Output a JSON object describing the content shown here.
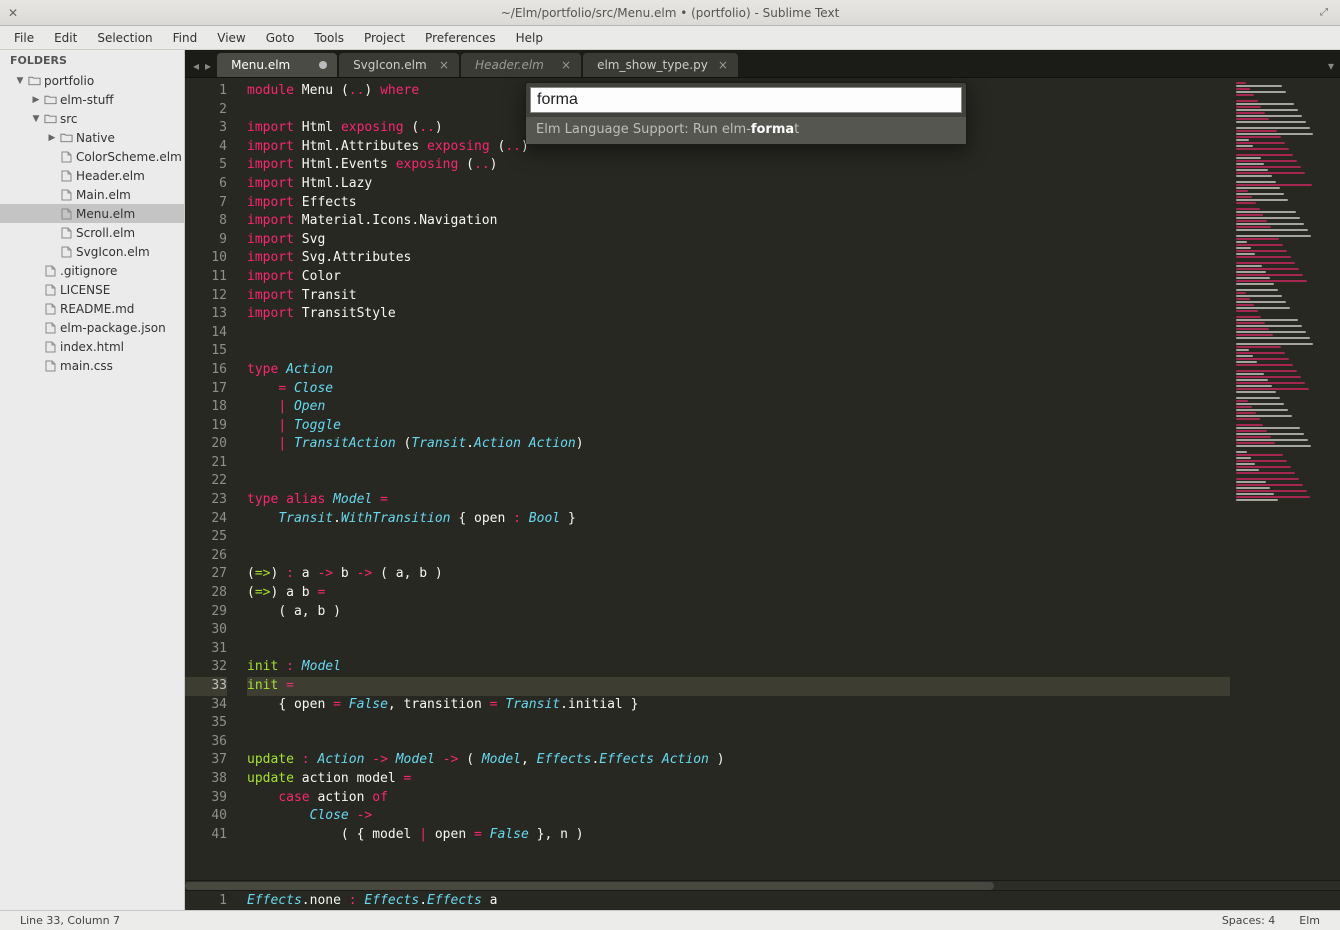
{
  "window": {
    "title": "~/Elm/portfolio/src/Menu.elm • (portfolio) - Sublime Text"
  },
  "menubar": [
    "File",
    "Edit",
    "Selection",
    "Find",
    "View",
    "Goto",
    "Tools",
    "Project",
    "Preferences",
    "Help"
  ],
  "sidebar": {
    "header": "FOLDERS",
    "tree": [
      {
        "depth": 0,
        "kind": "folder",
        "open": true,
        "label": "portfolio"
      },
      {
        "depth": 1,
        "kind": "folder",
        "open": false,
        "label": "elm-stuff"
      },
      {
        "depth": 1,
        "kind": "folder",
        "open": true,
        "label": "src"
      },
      {
        "depth": 2,
        "kind": "folder",
        "open": false,
        "label": "Native"
      },
      {
        "depth": 2,
        "kind": "file",
        "label": "ColorScheme.elm"
      },
      {
        "depth": 2,
        "kind": "file",
        "label": "Header.elm"
      },
      {
        "depth": 2,
        "kind": "file",
        "label": "Main.elm"
      },
      {
        "depth": 2,
        "kind": "file",
        "label": "Menu.elm",
        "selected": true
      },
      {
        "depth": 2,
        "kind": "file",
        "label": "Scroll.elm"
      },
      {
        "depth": 2,
        "kind": "file",
        "label": "SvgIcon.elm"
      },
      {
        "depth": 1,
        "kind": "file",
        "label": ".gitignore"
      },
      {
        "depth": 1,
        "kind": "file",
        "label": "LICENSE"
      },
      {
        "depth": 1,
        "kind": "file",
        "label": "README.md"
      },
      {
        "depth": 1,
        "kind": "file",
        "label": "elm-package.json"
      },
      {
        "depth": 1,
        "kind": "file",
        "label": "index.html"
      },
      {
        "depth": 1,
        "kind": "file",
        "label": "main.css"
      }
    ]
  },
  "tabs": [
    {
      "label": "Menu.elm",
      "active": true,
      "dirty": true
    },
    {
      "label": "SvgIcon.elm",
      "active": false,
      "dirty": false
    },
    {
      "label": "Header.elm",
      "active": false,
      "dirty": false,
      "italic": true
    },
    {
      "label": "elm_show_type.py",
      "active": false,
      "dirty": false
    }
  ],
  "palette": {
    "input": "forma",
    "result_prefix": "Elm Language Support: Run elm-",
    "result_match": "forma",
    "result_suffix": "t"
  },
  "code": {
    "start_line": 1,
    "current_line": 33,
    "lines": [
      [
        [
          "kw",
          "module"
        ],
        [
          "ident",
          " Menu "
        ],
        [
          "punc",
          "("
        ],
        [
          "op",
          ".."
        ],
        [
          "punc",
          ") "
        ],
        [
          "kw",
          "where"
        ]
      ],
      [],
      [
        [
          "kw",
          "import"
        ],
        [
          "ident",
          " Html "
        ],
        [
          "kw",
          "exposing"
        ],
        [
          "punc",
          " ("
        ],
        [
          "op",
          ".."
        ],
        [
          "punc",
          ")"
        ]
      ],
      [
        [
          "kw",
          "import"
        ],
        [
          "ident",
          " Html.Attributes "
        ],
        [
          "kw",
          "exposing"
        ],
        [
          "punc",
          " ("
        ],
        [
          "op",
          ".."
        ],
        [
          "punc",
          ")"
        ]
      ],
      [
        [
          "kw",
          "import"
        ],
        [
          "ident",
          " Html.Events "
        ],
        [
          "kw",
          "exposing"
        ],
        [
          "punc",
          " ("
        ],
        [
          "op",
          ".."
        ],
        [
          "punc",
          ")"
        ]
      ],
      [
        [
          "kw",
          "import"
        ],
        [
          "ident",
          " Html.Lazy"
        ]
      ],
      [
        [
          "kw",
          "import"
        ],
        [
          "ident",
          " Effects"
        ]
      ],
      [
        [
          "kw",
          "import"
        ],
        [
          "ident",
          " Material.Icons.Navigation"
        ]
      ],
      [
        [
          "kw",
          "import"
        ],
        [
          "ident",
          " Svg"
        ]
      ],
      [
        [
          "kw",
          "import"
        ],
        [
          "ident",
          " Svg.Attributes"
        ]
      ],
      [
        [
          "kw",
          "import"
        ],
        [
          "ident",
          " Color"
        ]
      ],
      [
        [
          "kw",
          "import"
        ],
        [
          "ident",
          " Transit"
        ]
      ],
      [
        [
          "kw",
          "import"
        ],
        [
          "ident",
          " TransitStyle"
        ]
      ],
      [],
      [],
      [
        [
          "kw",
          "type"
        ],
        [
          "ident",
          " "
        ],
        [
          "type",
          "Action"
        ]
      ],
      [
        [
          "ident",
          "    "
        ],
        [
          "op",
          "="
        ],
        [
          "ident",
          " "
        ],
        [
          "const",
          "Close"
        ]
      ],
      [
        [
          "ident",
          "    "
        ],
        [
          "op",
          "|"
        ],
        [
          "ident",
          " "
        ],
        [
          "const",
          "Open"
        ]
      ],
      [
        [
          "ident",
          "    "
        ],
        [
          "op",
          "|"
        ],
        [
          "ident",
          " "
        ],
        [
          "const",
          "Toggle"
        ]
      ],
      [
        [
          "ident",
          "    "
        ],
        [
          "op",
          "|"
        ],
        [
          "ident",
          " "
        ],
        [
          "const",
          "TransitAction"
        ],
        [
          "punc",
          " ("
        ],
        [
          "type",
          "Transit"
        ],
        [
          "punc",
          "."
        ],
        [
          "type",
          "Action"
        ],
        [
          "ident",
          " "
        ],
        [
          "type",
          "Action"
        ],
        [
          "punc",
          ")"
        ]
      ],
      [],
      [],
      [
        [
          "kw",
          "type"
        ],
        [
          "ident",
          " "
        ],
        [
          "kw",
          "alias"
        ],
        [
          "ident",
          " "
        ],
        [
          "type",
          "Model"
        ],
        [
          "ident",
          " "
        ],
        [
          "op",
          "="
        ]
      ],
      [
        [
          "ident",
          "    "
        ],
        [
          "type",
          "Transit"
        ],
        [
          "punc",
          "."
        ],
        [
          "type",
          "WithTransition"
        ],
        [
          "ident",
          " "
        ],
        [
          "punc",
          "{"
        ],
        [
          "ident",
          " open "
        ],
        [
          "op",
          ":"
        ],
        [
          "ident",
          " "
        ],
        [
          "type",
          "Bool"
        ],
        [
          "ident",
          " "
        ],
        [
          "punc",
          "}"
        ]
      ],
      [],
      [],
      [
        [
          "punc",
          "("
        ],
        [
          "fn",
          "=>"
        ],
        [
          "punc",
          ") "
        ],
        [
          "op",
          ":"
        ],
        [
          "ident",
          " a "
        ],
        [
          "op",
          "->"
        ],
        [
          "ident",
          " b "
        ],
        [
          "op",
          "->"
        ],
        [
          "ident",
          " "
        ],
        [
          "punc",
          "("
        ],
        [
          "ident",
          " a"
        ],
        [
          "punc",
          ","
        ],
        [
          "ident",
          " b "
        ],
        [
          "punc",
          ")"
        ]
      ],
      [
        [
          "punc",
          "("
        ],
        [
          "fn",
          "=>"
        ],
        [
          "punc",
          ")"
        ],
        [
          "ident",
          " a b "
        ],
        [
          "op",
          "="
        ]
      ],
      [
        [
          "ident",
          "    "
        ],
        [
          "punc",
          "("
        ],
        [
          "ident",
          " a"
        ],
        [
          "punc",
          ","
        ],
        [
          "ident",
          " b "
        ],
        [
          "punc",
          ")"
        ]
      ],
      [],
      [],
      [
        [
          "fn",
          "init"
        ],
        [
          "ident",
          " "
        ],
        [
          "op",
          ":"
        ],
        [
          "ident",
          " "
        ],
        [
          "type",
          "Model"
        ]
      ],
      [
        [
          "fn",
          "init"
        ],
        [
          "ident",
          " "
        ],
        [
          "op",
          "="
        ]
      ],
      [
        [
          "ident",
          "    "
        ],
        [
          "punc",
          "{"
        ],
        [
          "ident",
          " open "
        ],
        [
          "op",
          "="
        ],
        [
          "ident",
          " "
        ],
        [
          "const",
          "False"
        ],
        [
          "punc",
          ","
        ],
        [
          "ident",
          " transition "
        ],
        [
          "op",
          "="
        ],
        [
          "ident",
          " "
        ],
        [
          "type",
          "Transit"
        ],
        [
          "punc",
          "."
        ],
        [
          "ident",
          "initial "
        ],
        [
          "punc",
          "}"
        ]
      ],
      [],
      [],
      [
        [
          "fn",
          "update"
        ],
        [
          "ident",
          " "
        ],
        [
          "op",
          ":"
        ],
        [
          "ident",
          " "
        ],
        [
          "type",
          "Action"
        ],
        [
          "ident",
          " "
        ],
        [
          "op",
          "->"
        ],
        [
          "ident",
          " "
        ],
        [
          "type",
          "Model"
        ],
        [
          "ident",
          " "
        ],
        [
          "op",
          "->"
        ],
        [
          "ident",
          " "
        ],
        [
          "punc",
          "("
        ],
        [
          "ident",
          " "
        ],
        [
          "type",
          "Model"
        ],
        [
          "punc",
          ","
        ],
        [
          "ident",
          " "
        ],
        [
          "type",
          "Effects"
        ],
        [
          "punc",
          "."
        ],
        [
          "type",
          "Effects"
        ],
        [
          "ident",
          " "
        ],
        [
          "type",
          "Action"
        ],
        [
          "ident",
          " "
        ],
        [
          "punc",
          ")"
        ]
      ],
      [
        [
          "fn",
          "update"
        ],
        [
          "ident",
          " action model "
        ],
        [
          "op",
          "="
        ]
      ],
      [
        [
          "ident",
          "    "
        ],
        [
          "kw",
          "case"
        ],
        [
          "ident",
          " action "
        ],
        [
          "kw",
          "of"
        ]
      ],
      [
        [
          "ident",
          "        "
        ],
        [
          "const",
          "Close"
        ],
        [
          "ident",
          " "
        ],
        [
          "op",
          "->"
        ]
      ],
      [
        [
          "ident",
          "            "
        ],
        [
          "punc",
          "("
        ],
        [
          "ident",
          " "
        ],
        [
          "punc",
          "{"
        ],
        [
          "ident",
          " model "
        ],
        [
          "op",
          "|"
        ],
        [
          "ident",
          " open "
        ],
        [
          "op",
          "="
        ],
        [
          "ident",
          " "
        ],
        [
          "const",
          "False"
        ],
        [
          "ident",
          " "
        ],
        [
          "punc",
          "}"
        ],
        [
          "punc",
          ","
        ],
        [
          "ident",
          " n "
        ],
        [
          "punc",
          ")"
        ]
      ]
    ]
  },
  "bottom_pane": {
    "line_no": "1",
    "tokens": [
      [
        "type",
        "Effects"
      ],
      [
        "punc",
        "."
      ],
      [
        "ident",
        "none "
      ],
      [
        "op",
        ":"
      ],
      [
        "ident",
        " "
      ],
      [
        "type",
        "Effects"
      ],
      [
        "punc",
        "."
      ],
      [
        "type",
        "Effects"
      ],
      [
        "ident",
        " a"
      ]
    ]
  },
  "statusbar": {
    "left": "Line 33, Column 7",
    "spaces": "Spaces: 4",
    "syntax": "Elm"
  }
}
